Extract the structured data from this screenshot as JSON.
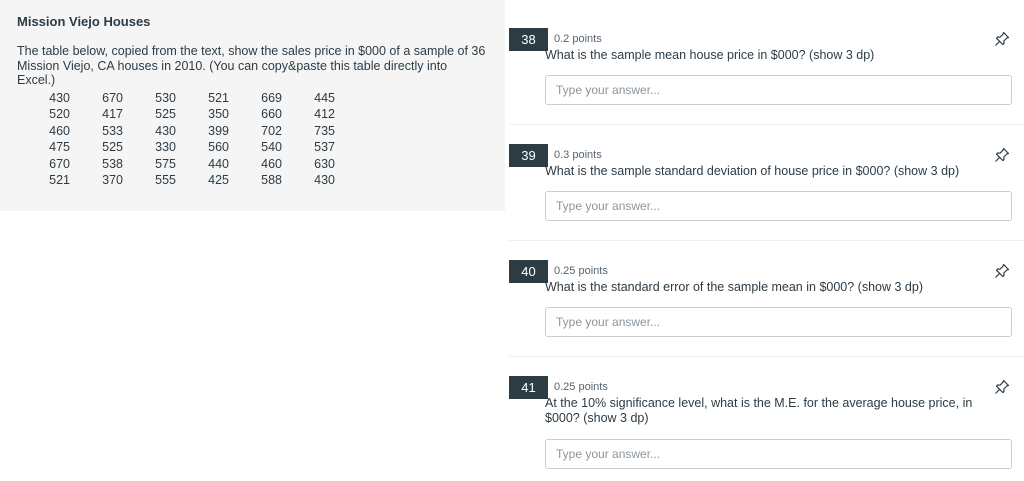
{
  "context": {
    "title": "Mission Viejo Houses",
    "description": "The table below, copied from the text, show the sales price in $000 of a sample of 36 Mission Viejo, CA houses in 2010. (You can copy&paste this table directly into Excel.)",
    "table": [
      [
        "430",
        "670",
        "530",
        "521",
        "669",
        "445"
      ],
      [
        "520",
        "417",
        "525",
        "350",
        "660",
        "412"
      ],
      [
        "460",
        "533",
        "430",
        "399",
        "702",
        "735"
      ],
      [
        "475",
        "525",
        "330",
        "560",
        "540",
        "537"
      ],
      [
        "670",
        "538",
        "575",
        "440",
        "460",
        "630"
      ],
      [
        "521",
        "370",
        "555",
        "425",
        "588",
        "430"
      ]
    ]
  },
  "questions": [
    {
      "number": "38",
      "points": "0.2 points",
      "text": "What is the sample mean house price in $000? (show 3 dp)",
      "placeholder": "Type your answer...",
      "icon": "pin-icon"
    },
    {
      "number": "39",
      "points": "0.3 points",
      "text": "What is the sample standard deviation of house price in $000? (show 3 dp)",
      "placeholder": "Type your answer...",
      "icon": "pin-icon"
    },
    {
      "number": "40",
      "points": "0.25 points",
      "text": "What is the standard error of the sample mean in $000? (show 3 dp)",
      "placeholder": "Type your answer...",
      "icon": "pin-icon"
    },
    {
      "number": "41",
      "points": "0.25 points",
      "text": "At the 10% significance level, what is the M.E. for the average house price, in $000? (show 3 dp)",
      "placeholder": "Type your answer...",
      "icon": "pin-icon"
    }
  ],
  "colors": {
    "badge_background": "#2d3b45",
    "panel_background": "#f5f5f5",
    "input_border": "#c7cdd1"
  }
}
